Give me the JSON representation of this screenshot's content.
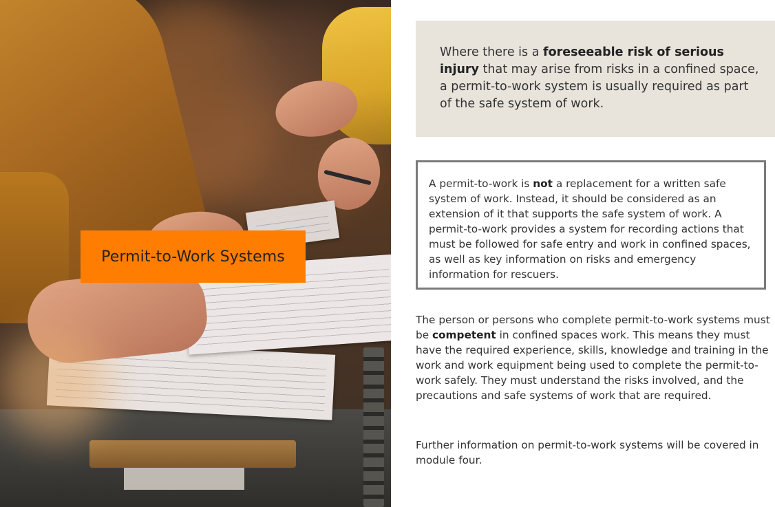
{
  "banner": {
    "title": "Permit-to-Work Systems",
    "background_color": "#ff7d00"
  },
  "callout": {
    "before": "Where there is a ",
    "bold": "foreseeable risk of serious injury",
    "after": " that may arise from risks in a confined space, a permit-to-work system is usually required as part of the safe system of work.",
    "background_color": "#e8e4dc"
  },
  "boxed_note": {
    "before": "A permit-to-work is ",
    "bold": "not",
    "after": " a replacement for a written safe system of work. Instead, it should be considered as an extension of it that supports the safe system of work. A permit-to-work provides a system for recording actions that must be followed for safe entry and work in confined spaces, as well as key information on risks and emergency information for rescuers.",
    "border_color": "#7b7b7b"
  },
  "competence_paragraph": {
    "before": "The person or persons who complete permit-to-work systems must be ",
    "bold": "competent",
    "after": " in confined spaces work. This means they must have the required experience, skills, knowledge and training in the work and work equipment being used to complete the permit-to-work safely. They must understand the risks involved, and the precautions and safe systems of work that are required."
  },
  "further_info": {
    "text": "Further information on permit-to-work systems will be covered in module four."
  }
}
